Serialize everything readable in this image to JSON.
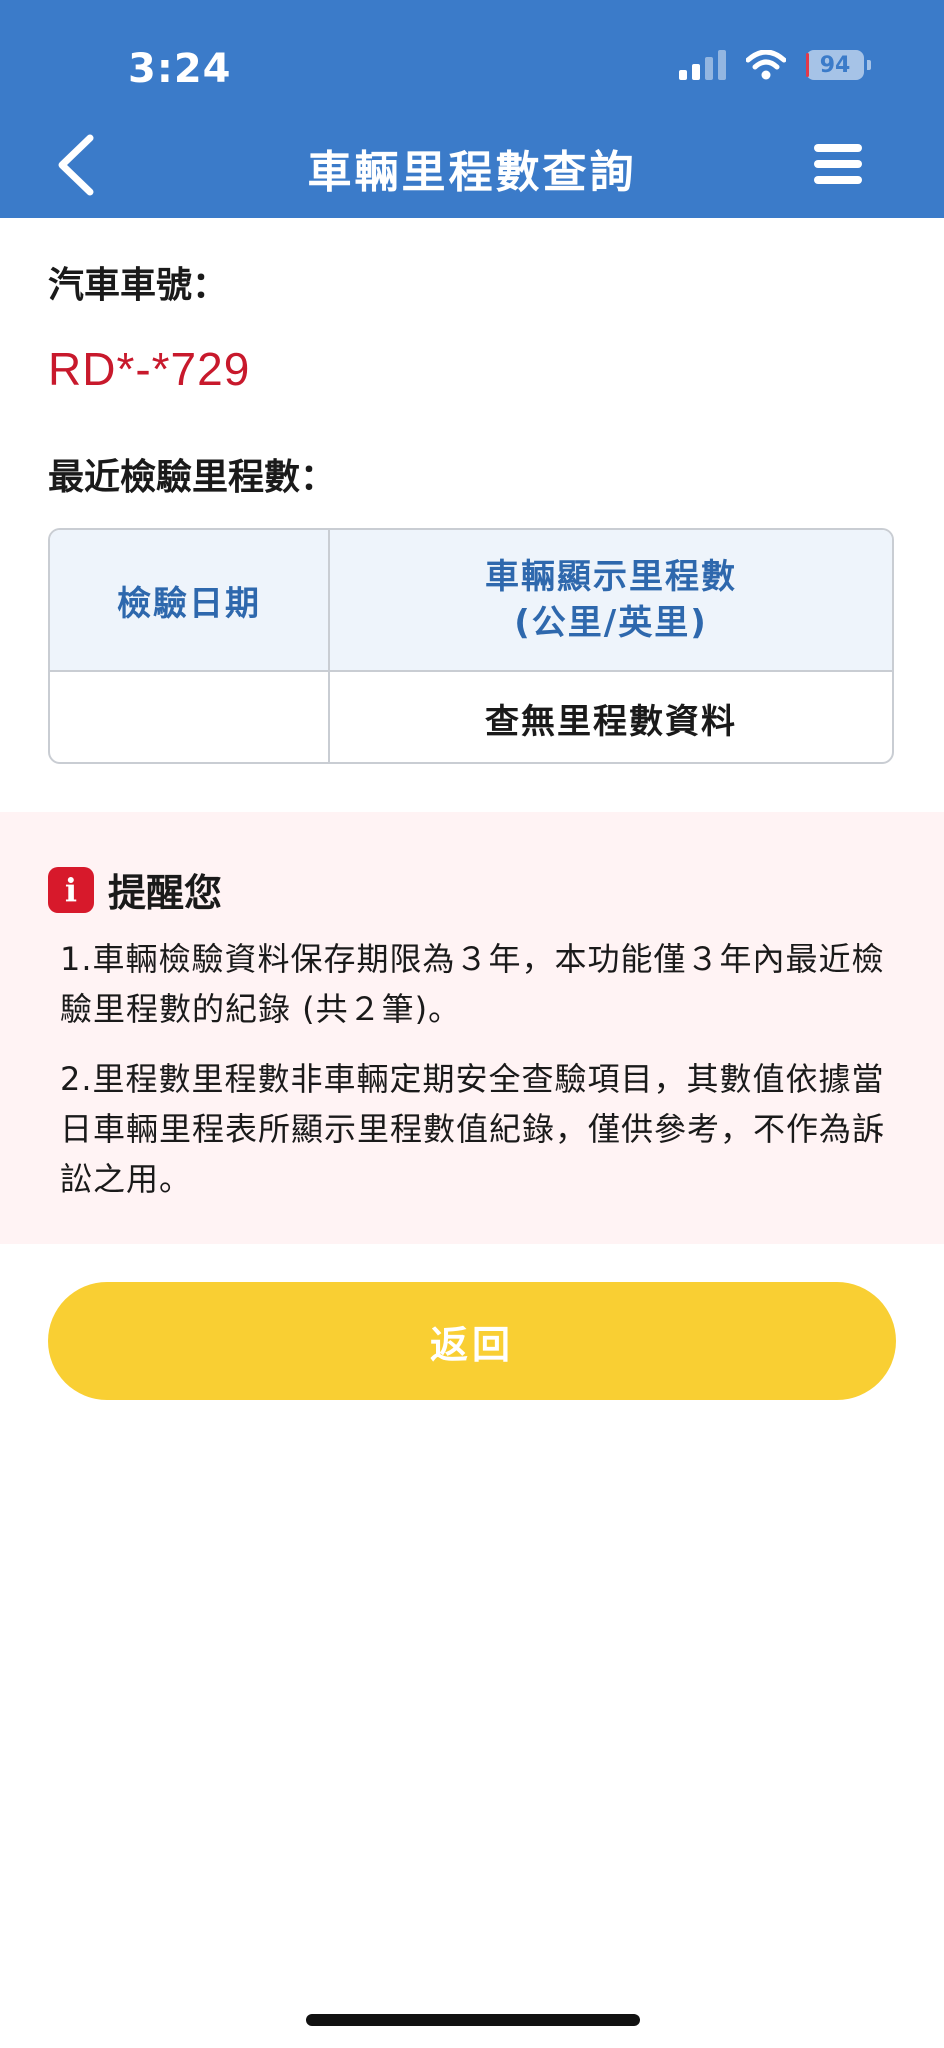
{
  "status_bar": {
    "time": "3:24",
    "battery": "94"
  },
  "header": {
    "title": "車輛里程數查詢"
  },
  "vehicle": {
    "plate_label": "汽車車號：",
    "plate_number": "RD*-*729"
  },
  "mileage": {
    "section_label": "最近檢驗里程數：",
    "col_date": "檢驗日期",
    "col_mileage_line1": "車輛顯示里程數",
    "col_mileage_line2": "(公里/英里)",
    "row_date": "",
    "row_mileage": "查無里程數資料"
  },
  "reminder": {
    "title": "提醒您",
    "icon_glyph": "i",
    "note1": "1.車輛檢驗資料保存期限為３年，本功能僅３年內最近檢驗里程數的紀錄 (共２筆)。",
    "note2": "2.里程數里程數非車輛定期安全查驗項目，其數值依據當日車輛里程表所顯示里程數值紀錄，僅供參考，不作為訴訟之用。"
  },
  "actions": {
    "return_label": "返回"
  },
  "colors": {
    "header_bg": "#3b7bc9",
    "plate_red": "#c8192c",
    "reminder_bg": "#fff3f4",
    "button_yellow": "#f9cf33"
  }
}
